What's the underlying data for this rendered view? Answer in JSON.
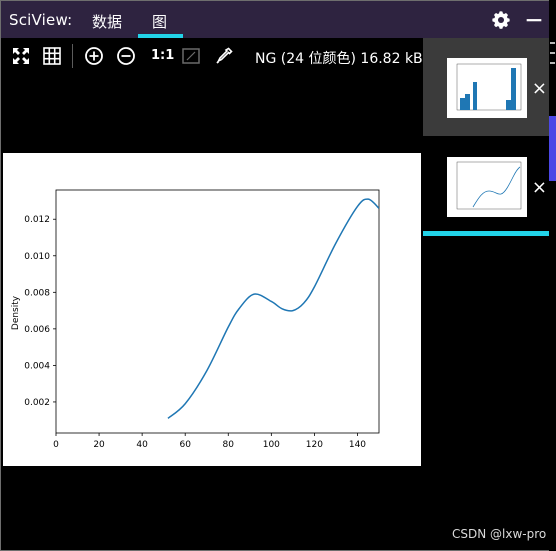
{
  "header": {
    "app_title": "SciView:",
    "tabs": [
      {
        "label": "数据",
        "active": false
      },
      {
        "label": "图",
        "active": true
      }
    ],
    "settings_icon": "gear-icon",
    "minimize_icon": "minimize-icon",
    "accent_color": "#22d3e8"
  },
  "toolbar": {
    "tools": [
      "fit-icon",
      "grid-icon",
      "zoom-in-icon",
      "zoom-out-icon",
      "actual-size-icon",
      "background-icon",
      "color-picker-icon"
    ],
    "actual_size_label": "1:1",
    "image_info": "NG (24 位颜色) 16.82 kB"
  },
  "plot": {
    "ylabel": "Density",
    "x_ticks": [
      "0",
      "20",
      "40",
      "60",
      "80",
      "100",
      "120",
      "140"
    ],
    "y_ticks": [
      "0.002",
      "0.004",
      "0.006",
      "0.008",
      "0.010",
      "0.012"
    ]
  },
  "chart_data": {
    "type": "line",
    "ylabel": "Density",
    "xlabel": "",
    "xlim": [
      0,
      150
    ],
    "ylim": [
      0.0003,
      0.0136
    ],
    "series": [
      {
        "x": [
          52,
          60,
          70,
          80,
          85,
          92,
          100,
          105,
          110,
          115,
          120,
          130,
          140,
          145,
          150
        ],
        "y": [
          0.0011,
          0.0019,
          0.0037,
          0.0061,
          0.0071,
          0.0079,
          0.0075,
          0.0071,
          0.007,
          0.0074,
          0.0083,
          0.0107,
          0.0127,
          0.0131,
          0.0126
        ]
      }
    ]
  },
  "thumbnails": [
    {
      "name": "histogram-thumbnail",
      "selected": false,
      "close_label": "×"
    },
    {
      "name": "density-thumbnail",
      "selected": true,
      "close_label": "×"
    }
  ],
  "watermark": "CSDN @lxw-pro"
}
